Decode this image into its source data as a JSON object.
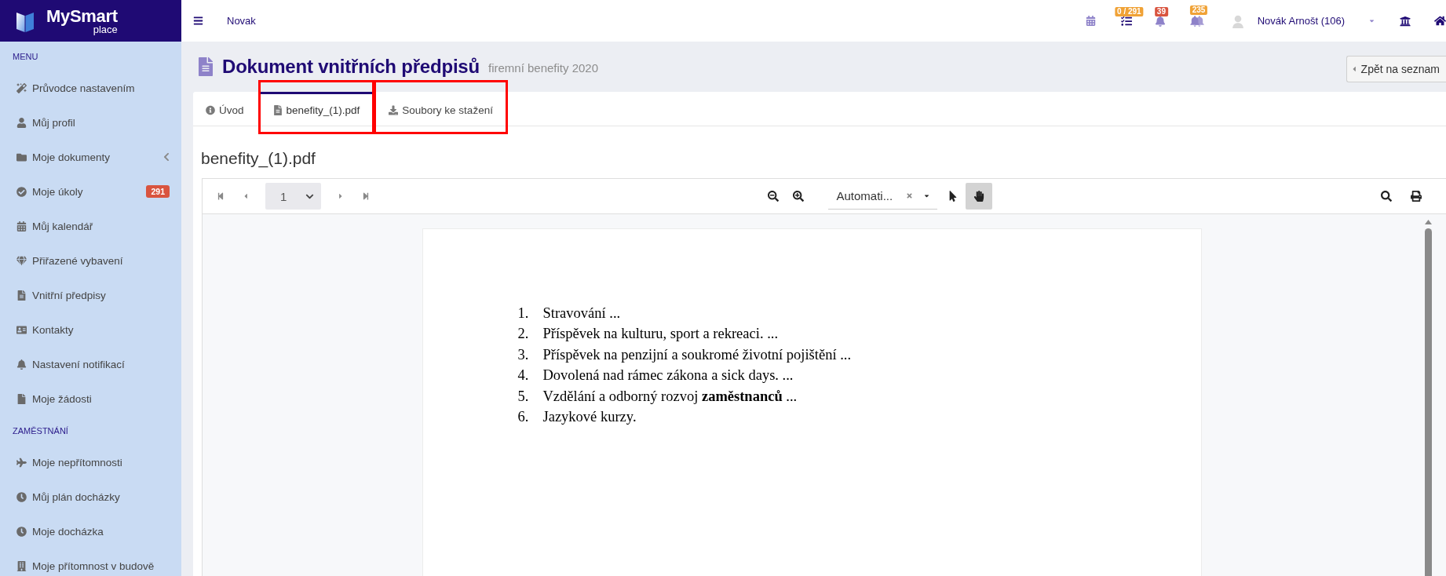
{
  "sidebar": {
    "logo": {
      "name": "MySmart",
      "tagline": "place"
    },
    "sections": [
      {
        "heading": "MENU",
        "items": [
          {
            "label": "Průvodce nastavením"
          },
          {
            "label": "Můj profil"
          },
          {
            "label": "Moje dokumenty",
            "expanded": false
          },
          {
            "label": "Moje úkoly",
            "badge": "291"
          },
          {
            "label": "Můj kalendář"
          },
          {
            "label": "Přiřazené vybavení"
          },
          {
            "label": "Vnitřní předpisy"
          },
          {
            "label": "Kontakty"
          },
          {
            "label": "Nastavení notifikací"
          },
          {
            "label": "Moje žádosti"
          }
        ]
      },
      {
        "heading": "ZAMĚSTNÁNÍ",
        "items": [
          {
            "label": "Moje nepřítomnosti"
          },
          {
            "label": "Můj plán docházky"
          },
          {
            "label": "Moje docházka"
          },
          {
            "label": "Moje přítomnost v budově"
          }
        ]
      }
    ]
  },
  "topbar": {
    "label": "Novak",
    "indicators": [
      {
        "badge": "0 / 291",
        "color": "#f0a236"
      },
      {
        "badge": "39",
        "color": "#d9543f"
      },
      {
        "badge": "235",
        "color": "#f0a236"
      }
    ],
    "user": {
      "name": "Novák Arnošt (106)"
    }
  },
  "page": {
    "title": "Dokument vnitřních předpisů",
    "subtitle": "firemní benefity 2020",
    "back_button": "Zpět na seznam"
  },
  "tabs": [
    {
      "label": "Úvod",
      "selected": false,
      "highlighted": false
    },
    {
      "label": "benefity_(1).pdf",
      "selected": true,
      "highlighted": true
    },
    {
      "label": "Soubory ke stažení",
      "selected": false,
      "highlighted": true
    }
  ],
  "document": {
    "heading": "benefity_(1).pdf",
    "viewer": {
      "page_number": "1",
      "zoom": "Automati...",
      "tools": [
        {
          "kind": "select",
          "selected": false
        },
        {
          "kind": "hand",
          "selected": true
        }
      ],
      "items": [
        {
          "number": "1.",
          "text": "Stravování ..."
        },
        {
          "number": "2.",
          "text": "Příspěvek na kulturu, sport a rekreaci. ..."
        },
        {
          "number": "3.",
          "text": "Příspěvek na penzijní a soukromé životní pojištění ..."
        },
        {
          "number": "4.",
          "text": "Dovolená nad rámec zákona a sick days. ..."
        },
        {
          "number": "5.",
          "text": "Vzdělání a odborný rozvoj **zaměstnanců** ..."
        },
        {
          "number": "6.",
          "text": "Jazykové kurzy."
        }
      ]
    }
  }
}
